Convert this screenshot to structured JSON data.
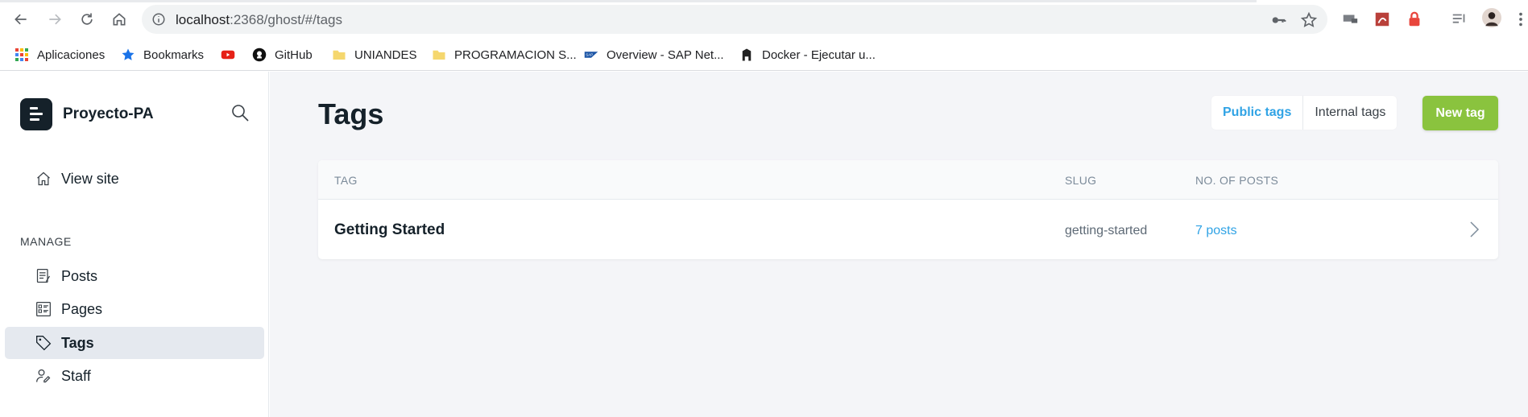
{
  "browser": {
    "url_host": "localhost",
    "url_rest": ":2368/ghost/#/tags",
    "bookmarks": [
      {
        "label": "Aplicaciones",
        "icon": "apps-grid-icon"
      },
      {
        "label": "Bookmarks",
        "icon": "star-icon"
      },
      {
        "label": "",
        "icon": "youtube-icon"
      },
      {
        "label": "GitHub",
        "icon": "github-icon"
      },
      {
        "label": "UNIANDES",
        "icon": "folder-icon"
      },
      {
        "label": "PROGRAMACION S...",
        "icon": "folder-icon"
      },
      {
        "label": "Overview - SAP Net...",
        "icon": "sap-icon"
      },
      {
        "label": "Docker - Ejecutar u...",
        "icon": "docker-icon"
      }
    ]
  },
  "sidebar": {
    "site_name": "Proyecto-PA",
    "view_site": "View site",
    "section_label": "MANAGE",
    "items": [
      {
        "label": "Posts",
        "icon": "posts-icon"
      },
      {
        "label": "Pages",
        "icon": "pages-icon"
      },
      {
        "label": "Tags",
        "icon": "tag-icon",
        "active": true
      },
      {
        "label": "Staff",
        "icon": "staff-icon"
      }
    ]
  },
  "main": {
    "title": "Tags",
    "filter": {
      "public": "Public tags",
      "internal": "Internal tags",
      "selected": "Public tags"
    },
    "new_button": "New tag",
    "table": {
      "headers": [
        "TAG",
        "SLUG",
        "NO. OF POSTS"
      ],
      "rows": [
        {
          "name": "Getting Started",
          "slug": "getting-started",
          "count": "7 posts"
        }
      ]
    }
  },
  "colors": {
    "accent": "#30a3e5",
    "primary_button": "#8ac33e",
    "sidebar_active": "#e5e9ef",
    "main_bg": "#f4f5f8"
  }
}
